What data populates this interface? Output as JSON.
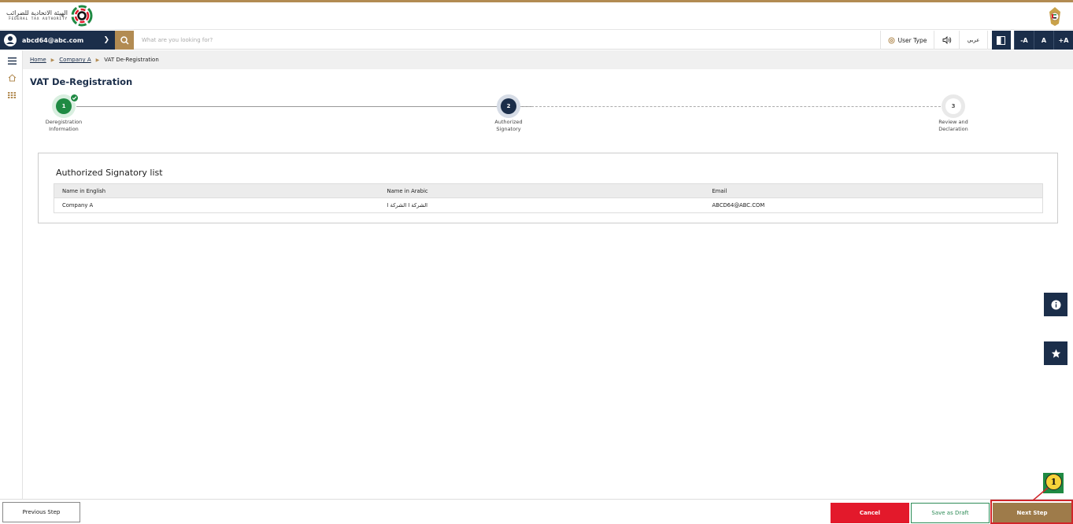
{
  "header": {
    "logo_ar": "الهيئة الاتحادية للضرائب",
    "logo_en": "FEDERAL TAX AUTHORITY"
  },
  "navbar": {
    "user_email": "abcd64@abc.com",
    "search_placeholder": "What are you looking for?",
    "user_type": "User Type",
    "arabic_toggle": "عربي",
    "font_decrease": "-A",
    "font_normal": "A",
    "font_increase": "+A"
  },
  "breadcrumb": {
    "home": "Home",
    "company": "Company A",
    "current": "VAT De-Registration"
  },
  "page": {
    "title": "VAT De-Registration"
  },
  "stepper": {
    "steps": [
      {
        "number": "1",
        "label_line1": "Deregistration",
        "label_line2": "Information",
        "state": "completed"
      },
      {
        "number": "2",
        "label_line1": "Authorized",
        "label_line2": "Signatory",
        "state": "active"
      },
      {
        "number": "3",
        "label_line1": "Review and",
        "label_line2": "Declaration",
        "state": "pending"
      }
    ]
  },
  "signatory": {
    "title": "Authorized Signatory list",
    "columns": [
      "Name in English",
      "Name in Arabic",
      "Email"
    ],
    "rows": [
      [
        "Company A",
        "الشركة ا الشركة ا",
        "ABCD64@ABC.COM"
      ]
    ]
  },
  "footer": {
    "previous": "Previous Step",
    "cancel": "Cancel",
    "save_draft": "Save as Draft",
    "next": "Next Step"
  },
  "annotation": {
    "badge": "1"
  },
  "colors": {
    "navy": "#1b2e4a",
    "gold": "#b28b52",
    "green": "#1f8a43",
    "red": "#e3192b"
  }
}
